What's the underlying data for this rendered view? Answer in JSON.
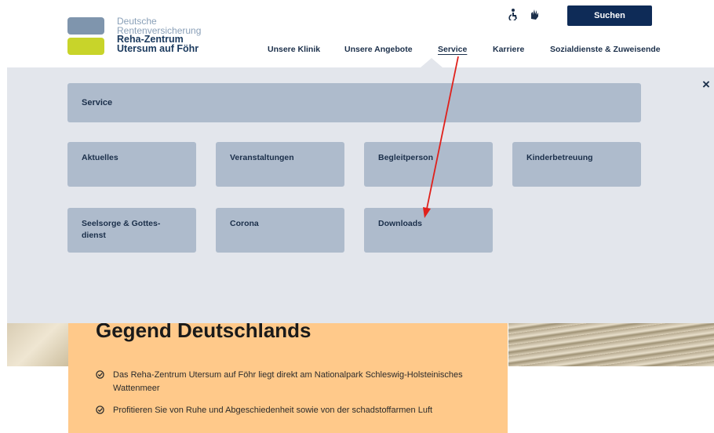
{
  "header": {
    "logo_lines": [
      "Deutsche",
      "Rentenversicherung",
      "Reha-Zentrum",
      "Utersum auf Föhr"
    ],
    "search_label": "Suchen",
    "icons": [
      "accessibility-icon",
      "sign-language-icon"
    ],
    "nav": [
      {
        "label": "Unsere Klinik",
        "active": false
      },
      {
        "label": "Unsere Angebote",
        "active": false
      },
      {
        "label": "Service",
        "active": true
      },
      {
        "label": "Karriere",
        "active": false
      },
      {
        "label": "Sozialdienste & Zuweisende",
        "active": false
      }
    ]
  },
  "menu": {
    "title": "Service",
    "items": [
      "Aktuelles",
      "Veranstaltungen",
      "Begleitperson",
      "Kinderbetreuung",
      "Seelsorge & Gottes- dienst",
      "Corona",
      "Downloads"
    ],
    "close_label": "×"
  },
  "hero": {
    "title": "Gegend Deutschlands",
    "bullets": [
      "Das Reha-Zentrum Utersum auf Föhr liegt direkt am Nationalpark Schleswig-Holsteinisches Wattenmeer",
      "Profitieren Sie von Ruhe und Abgeschiedenheit sowie von der schadstoffarmen Luft"
    ]
  },
  "colors": {
    "brand_navy": "#0e2b57",
    "tile": "#aebbcc",
    "overlay": "#e3e6ec",
    "logo_green": "#c8d42a",
    "annotation_arrow": "#e0201b",
    "hero_orange": "#ffc98a"
  }
}
